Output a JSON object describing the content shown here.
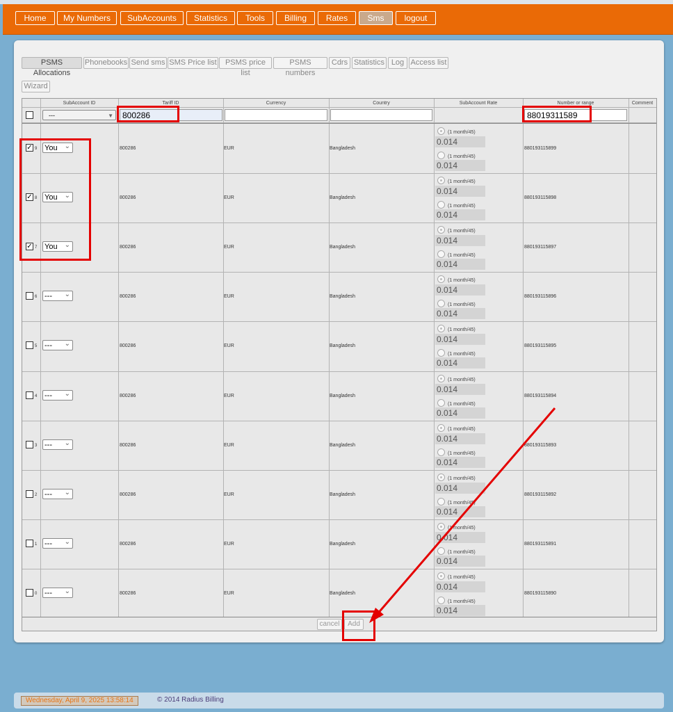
{
  "nav": {
    "items": [
      "Home",
      "My Numbers",
      "SubAccounts",
      "Statistics",
      "Tools",
      "Billing",
      "Rates",
      "Sms",
      "logout"
    ],
    "active": "Sms"
  },
  "subnav": {
    "items": [
      "PSMS Allocations",
      "Phonebooks",
      "Send sms",
      "SMS Price list",
      "PSMS price list",
      "PSMS numbers",
      "Cdrs",
      "Statistics",
      "Log",
      "Access list"
    ],
    "active": "PSMS Allocations"
  },
  "wizard_label": "Wizard",
  "table": {
    "headers": [
      "SubAccount ID",
      "Tariff ID",
      "Currency",
      "Country",
      "SubAccount Rate",
      "Number or range",
      "Comment"
    ],
    "filter": {
      "subaccount": "---",
      "tariff_id": "800286",
      "number": "88019311589"
    },
    "rows": [
      {
        "idx": "9",
        "checked": true,
        "sub": "You",
        "tariff": "800286",
        "currency": "EUR",
        "country": "Bangladesh",
        "rate1_label": "(1 month/45)",
        "rate1": "0.014",
        "rate2_label": "(1 month/45)",
        "rate2": "0.014",
        "number": "880193115899"
      },
      {
        "idx": "8",
        "checked": true,
        "sub": "You",
        "tariff": "800286",
        "currency": "EUR",
        "country": "Bangladesh",
        "rate1_label": "(1 month/45)",
        "rate1": "0.014",
        "rate2_label": "(1 month/45)",
        "rate2": "0.014",
        "number": "880193115898"
      },
      {
        "idx": "7",
        "checked": true,
        "sub": "You",
        "tariff": "800286",
        "currency": "EUR",
        "country": "Bangladesh",
        "rate1_label": "(1 month/45)",
        "rate1": "0.014",
        "rate2_label": "(1 month/45)",
        "rate2": "0.014",
        "number": "880193115897"
      },
      {
        "idx": "6",
        "checked": false,
        "sub": "---",
        "tariff": "800286",
        "currency": "EUR",
        "country": "Bangladesh",
        "rate1_label": "(1 month/45)",
        "rate1": "0.014",
        "rate2_label": "(1 month/45)",
        "rate2": "0.014",
        "number": "880193115896"
      },
      {
        "idx": "5",
        "checked": false,
        "sub": "---",
        "tariff": "800286",
        "currency": "EUR",
        "country": "Bangladesh",
        "rate1_label": "(1 month/45)",
        "rate1": "0.014",
        "rate2_label": "(1 month/45)",
        "rate2": "0.014",
        "number": "880193115895"
      },
      {
        "idx": "4",
        "checked": false,
        "sub": "---",
        "tariff": "800286",
        "currency": "EUR",
        "country": "Bangladesh",
        "rate1_label": "(1 month/45)",
        "rate1": "0.014",
        "rate2_label": "(1 month/45)",
        "rate2": "0.014",
        "number": "880193115894"
      },
      {
        "idx": "3",
        "checked": false,
        "sub": "---",
        "tariff": "800286",
        "currency": "EUR",
        "country": "Bangladesh",
        "rate1_label": "(1 month/45)",
        "rate1": "0.014",
        "rate2_label": "(1 month/45)",
        "rate2": "0.014",
        "number": "880193115893"
      },
      {
        "idx": "2",
        "checked": false,
        "sub": "---",
        "tariff": "800286",
        "currency": "EUR",
        "country": "Bangladesh",
        "rate1_label": "(1 month/45)",
        "rate1": "0.014",
        "rate2_label": "(1 month/45)",
        "rate2": "0.014",
        "number": "880193115892"
      },
      {
        "idx": "1",
        "checked": false,
        "sub": "---",
        "tariff": "800286",
        "currency": "EUR",
        "country": "Bangladesh",
        "rate1_label": "(1 month/45)",
        "rate1": "0.014",
        "rate2_label": "(1 month/45)",
        "rate2": "0.014",
        "number": "880193115891"
      },
      {
        "idx": "0",
        "checked": false,
        "sub": "---",
        "tariff": "800286",
        "currency": "EUR",
        "country": "Bangladesh",
        "rate1_label": "(1 month/45)",
        "rate1": "0.014",
        "rate2_label": "(1 month/45)",
        "rate2": "0.014",
        "number": "880193115890"
      }
    ]
  },
  "actions": {
    "cancel": "cancel",
    "add": "Add"
  },
  "footer": {
    "date": "Wednesday, April 9, 2025   13:58:14",
    "copyright": "© 2014 Radius Billing"
  },
  "colors": {
    "nav_bg": "#ea6a06",
    "page_bg": "#7aaed0",
    "annotation": "#e40000"
  }
}
